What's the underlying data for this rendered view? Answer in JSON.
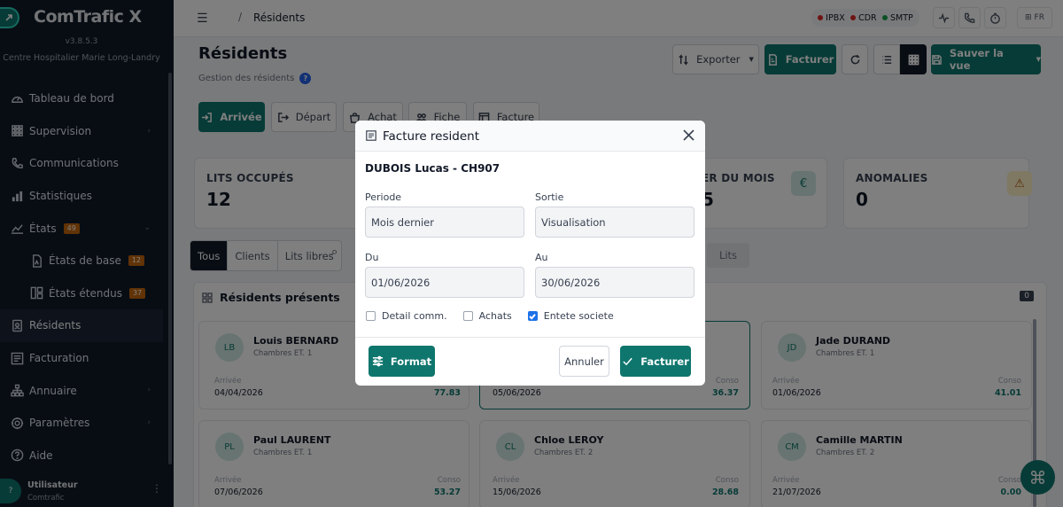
{
  "app": {
    "brand": "ComTrafic X",
    "version": "v3.8.5.3",
    "organization": "Centre Hospitalier Marie Long-Landry"
  },
  "sidebar": {
    "items": [
      {
        "label": "Tableau de bord",
        "icon": "gauge-icon"
      },
      {
        "label": "Supervision",
        "icon": "grid-icon",
        "chevron": "›"
      },
      {
        "label": "Communications",
        "icon": "phone-icon"
      },
      {
        "label": "Statistiques",
        "icon": "bar-chart-icon"
      },
      {
        "label": "États",
        "icon": "line-chart-icon",
        "badge": "49",
        "chevron": "⌄"
      },
      {
        "label": "États de base",
        "icon": "file-icon",
        "badge": "12"
      },
      {
        "label": "États étendus",
        "icon": "layout-icon",
        "badge": "37"
      },
      {
        "label": "Résidents",
        "icon": "id-card-icon"
      },
      {
        "label": "Facturation",
        "icon": "invoice-icon"
      },
      {
        "label": "Annuaire",
        "icon": "sitemap-icon",
        "chevron": "›"
      },
      {
        "label": "Paramètres",
        "icon": "gear-icon",
        "chevron": "›"
      },
      {
        "label": "Aide",
        "icon": "help-icon"
      }
    ],
    "user": {
      "avatar": "?",
      "name": "Utilisateur",
      "role": "Comtrafic",
      "menu": "⋮"
    }
  },
  "topbar": {
    "breadcrumb_sep": "/",
    "breadcrumb": "Résidents",
    "status": [
      {
        "label": "IPBX",
        "color": "#dc2626"
      },
      {
        "label": "CDR",
        "color": "#dc2626"
      },
      {
        "label": "SMTP",
        "color": "#16a34a"
      }
    ],
    "lang": "FR"
  },
  "page": {
    "title": "Résidents",
    "subtitle": "Gestion des résidents",
    "help": "?",
    "toolbar": {
      "export_label": "Exporter",
      "invoice_label": "Facturer",
      "save_view_label": "Sauver la vue"
    },
    "actions": [
      {
        "label": "Arrivée"
      },
      {
        "label": "Départ"
      },
      {
        "label": "Achat"
      },
      {
        "label": "Fiche"
      },
      {
        "label": "Facture"
      }
    ],
    "stats": [
      {
        "label": "LITS OCCUPÉS",
        "value": "12"
      },
      {
        "label": "ER DU MOIS",
        "value": "5",
        "icon": "€"
      },
      {
        "label": "ANOMALIES",
        "value": "0",
        "icon": "⚠"
      }
    ],
    "filters": [
      "Tous",
      "Clients",
      "Lits libres"
    ],
    "lits_label": "Lits",
    "panel": {
      "title": "Résidents présents",
      "count": "0"
    },
    "residents": [
      {
        "initials": "LB",
        "name": "Louis BERNARD",
        "room": "Chambres ET. 1",
        "arrival_label": "Arrivée",
        "arrival": "04/04/2026",
        "conso_label": "",
        "conso": "77.83"
      },
      {
        "initials": "",
        "name": "",
        "room": "",
        "arrival_label": "",
        "arrival": "05/06/2026",
        "conso_label": "Conso",
        "conso": "36.37"
      },
      {
        "initials": "JD",
        "name": "Jade DURAND",
        "room": "Chambres ET. 1",
        "arrival_label": "Arrivée",
        "arrival": "01/06/2026",
        "conso_label": "Conso",
        "conso": "41.01"
      },
      {
        "initials": "PL",
        "name": "Paul LAURENT",
        "room": "Chambres ET. 1",
        "arrival_label": "Arrivée",
        "arrival": "07/06/2026",
        "conso_label": "Conso",
        "conso": "53.27"
      },
      {
        "initials": "CL",
        "name": "Chloe LEROY",
        "room": "Chambres ET. 2",
        "arrival_label": "Arrivée",
        "arrival": "15/06/2026",
        "conso_label": "Conso",
        "conso": "28.68"
      },
      {
        "initials": "CM",
        "name": "Camille MARTIN",
        "room": "Chambres ET. 2",
        "arrival_label": "Arrivée",
        "arrival": "21/07/2026",
        "conso_label": "Conso",
        "conso": "0.00"
      }
    ]
  },
  "modal": {
    "title": "Facture resident",
    "resident": "DUBOIS Lucas - CH907",
    "periode_label": "Periode",
    "periode_value": "Mois dernier",
    "sortie_label": "Sortie",
    "sortie_value": "Visualisation",
    "du_label": "Du",
    "du_value": "01/06/2026",
    "au_label": "Au",
    "au_value": "30/06/2026",
    "checks": [
      {
        "label": "Detail comm.",
        "checked": false
      },
      {
        "label": "Achats",
        "checked": false
      },
      {
        "label": "Entete societe",
        "checked": true
      }
    ],
    "format_label": "Format",
    "cancel_label": "Annuler",
    "submit_label": "Facturer"
  },
  "colors": {
    "accent": "#0f766e",
    "sidebar_bg": "#111a29",
    "badge": "#c2670d",
    "checkbox": "#1d72e8"
  }
}
